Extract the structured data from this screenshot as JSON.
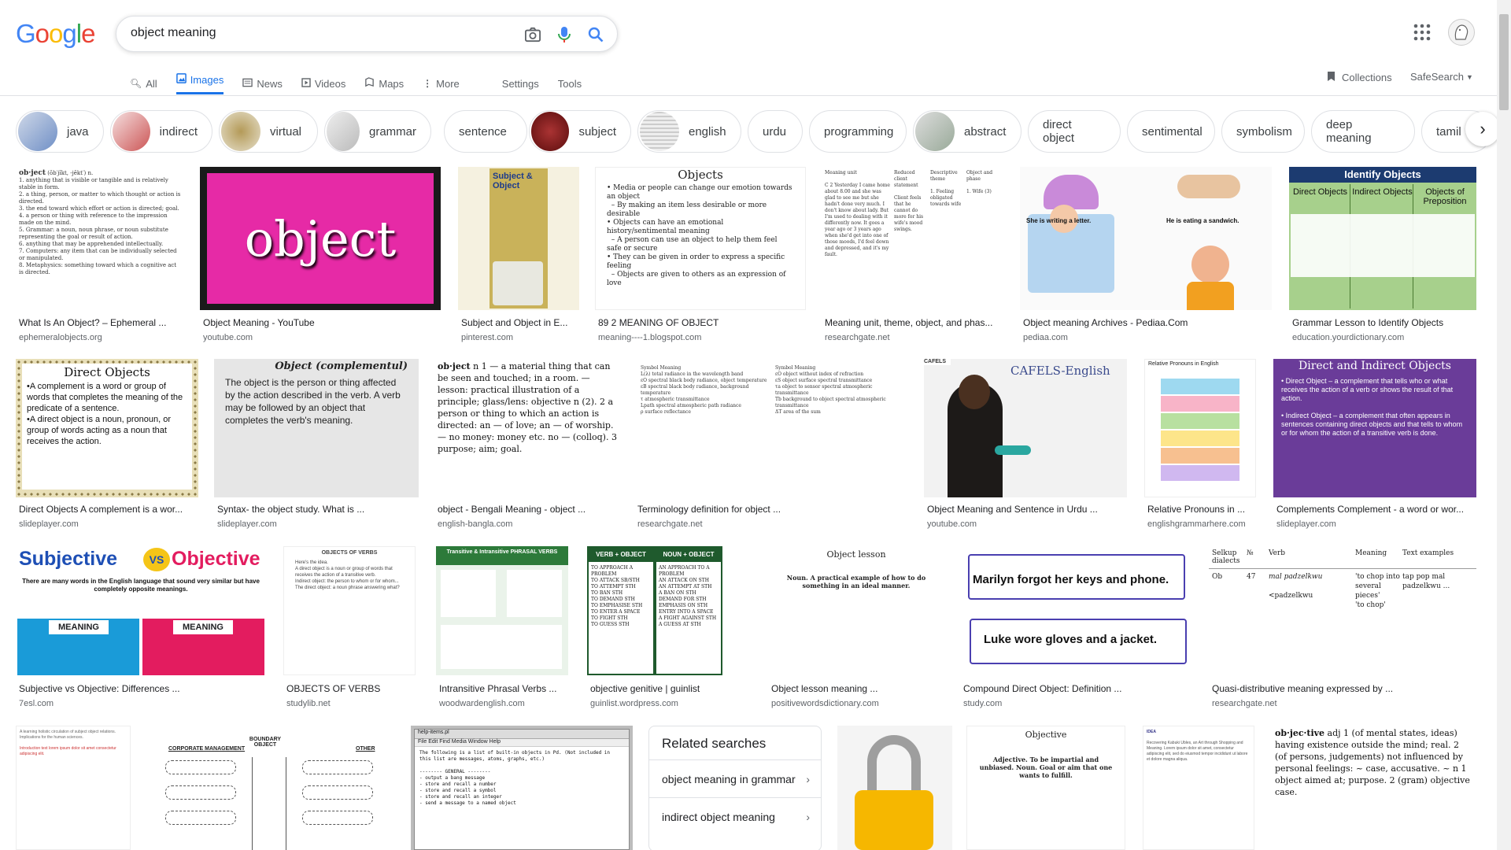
{
  "logo": {
    "letters": [
      "G",
      "o",
      "o",
      "g",
      "l",
      "e"
    ],
    "colors": [
      "#4285f4",
      "#ea4335",
      "#fbbc05",
      "#4285f4",
      "#34a853",
      "#ea4335"
    ]
  },
  "search": {
    "query": "object meaning"
  },
  "tabs": [
    {
      "label": "All",
      "icon": "search-icon"
    },
    {
      "label": "Images",
      "icon": "image-icon"
    },
    {
      "label": "News",
      "icon": "news-icon"
    },
    {
      "label": "Videos",
      "icon": "video-icon"
    },
    {
      "label": "Maps",
      "icon": "map-pin-icon"
    },
    {
      "label": "More",
      "icon": "more-vert-icon"
    }
  ],
  "tools": {
    "settings": "Settings",
    "tools": "Tools",
    "collections": "Collections",
    "safesearch": "SafeSearch"
  },
  "chips": [
    "java",
    "indirect",
    "virtual",
    "grammar",
    "sentence",
    "subject",
    "english",
    "urdu",
    "programming",
    "abstract",
    "direct object",
    "sentimental",
    "symbolism",
    "deep meaning",
    "tamil"
  ],
  "results": [
    {
      "title": "What Is An Object? – Ephemeral ...",
      "source": "ephemeralobjects.org"
    },
    {
      "title": "Object Meaning - YouTube",
      "source": "youtube.com",
      "big": "object"
    },
    {
      "title": "Subject and Object in E...",
      "source": "pinterest.com",
      "heading": "Subject & Object"
    },
    {
      "title": "89 2 MEANING OF OBJECT",
      "source": "meaning----1.blogspot.com",
      "heading": "Objects"
    },
    {
      "title": "Meaning unit, theme, object, and phas...",
      "source": "researchgate.net"
    },
    {
      "title": "Object meaning Archives - Pediaa.Com",
      "source": "pediaa.com",
      "cap1": "She is writing a letter.",
      "cap2": "He is eating a sandwich."
    },
    {
      "title": "Grammar Lesson to Identify Objects",
      "source": "education.yourdictionary.com",
      "heading": "Identify Objects",
      "cols": [
        "Direct Objects",
        "Indirect Objects",
        "Objects of Preposition"
      ]
    },
    {
      "title": "Direct Objects A complement is a wor...",
      "source": "slideplayer.com",
      "heading": "Direct Objects"
    },
    {
      "title": "Syntax- the object study. What is ...",
      "source": "slideplayer.com",
      "heading": "Object (complementul)"
    },
    {
      "title": "object - Bengali Meaning - object ...",
      "source": "english-bangla.com"
    },
    {
      "title": "Terminology definition for object ...",
      "source": "researchgate.net"
    },
    {
      "title": "Object Meaning and Sentence in Urdu ...",
      "source": "youtube.com",
      "heading": "CAFELS-English"
    },
    {
      "title": "Relative Pronouns in ...",
      "source": "englishgrammarhere.com",
      "heading": "Relative Pronouns in English"
    },
    {
      "title": "Complements Complement - a word or wor...",
      "source": "slideplayer.com",
      "heading": "Direct and Indirect Objects"
    },
    {
      "title": "Subjective vs Objective: Differences ...",
      "source": "7esl.com",
      "heading1": "Subjective",
      "heading2": "Objective",
      "vs": "VS",
      "meaning": "MEANING"
    },
    {
      "title": "OBJECTS OF VERBS",
      "source": "studylib.net",
      "heading": "OBJECTS OF VERBS"
    },
    {
      "title": "Intransitive Phrasal Verbs ...",
      "source": "woodwardenglish.com",
      "heading": "Transitive & Intransitive PHRASAL VERBS"
    },
    {
      "title": "objective genitive | guinlist",
      "source": "guinlist.wordpress.com",
      "col1": "VERB + OBJECT",
      "col2": "NOUN + OBJECT"
    },
    {
      "title": "Object lesson meaning ...",
      "source": "positivewordsdictionary.com",
      "heading": "Object lesson"
    },
    {
      "title": "Compound Direct Object: Definition ...",
      "source": "study.com",
      "s1": "Marilyn forgot her keys and phone.",
      "s2": "Luke wore gloves and a jacket."
    },
    {
      "title": "Quasi-distributive meaning expressed by ...",
      "source": "researchgate.net",
      "headers": [
        "Selkup dialects",
        "№",
        "Verb",
        "Meaning",
        "Text examples"
      ]
    }
  ],
  "related": {
    "title": "Related searches",
    "items": [
      "object meaning in grammar",
      "indirect object meaning"
    ]
  },
  "bottom_captions": {
    "objective": "Objective",
    "boundary": "BOUNDARY OBJECT",
    "corporate": "CORPORATE MANAGEMENT",
    "other": "OTHER"
  }
}
